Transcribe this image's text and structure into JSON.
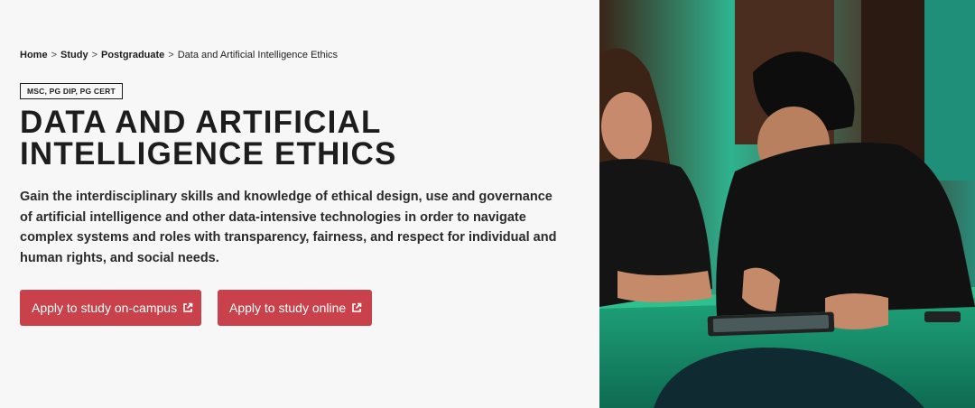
{
  "breadcrumb": {
    "home": "Home",
    "study": "Study",
    "postgraduate": "Postgraduate",
    "current": "Data and Artificial Intelligence Ethics",
    "separator": ">"
  },
  "course": {
    "tag": "MSC, PG DIP, PG CERT",
    "title_line1": "DATA AND ARTIFICIAL",
    "title_line2": "INTELLIGENCE ETHICS",
    "intro": "Gain the interdisciplinary skills and knowledge of ethical design, use and governance of artificial intelligence and other data-intensive technologies in order to navigate complex systems and roles with transparency, fairness, and respect for individual and human rights, and social needs."
  },
  "buttons": {
    "on_campus": "Apply to study on-campus",
    "online": "Apply to study online",
    "icon": "external-link-icon"
  },
  "colors": {
    "button": "#c8414b",
    "background": "#f7f7f7",
    "text": "#1d1d1d"
  }
}
